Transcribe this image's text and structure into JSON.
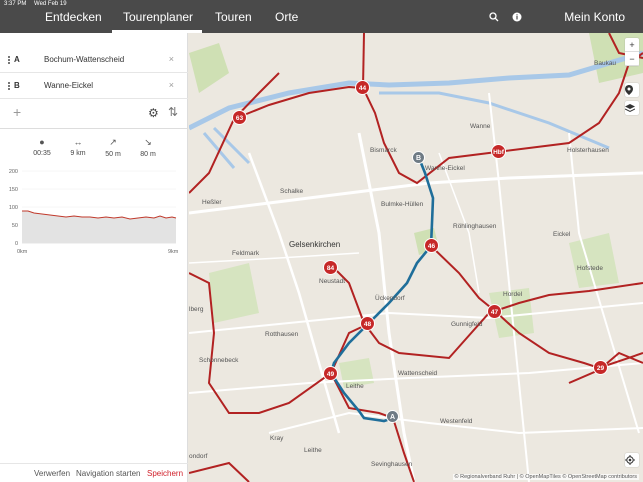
{
  "status": {
    "time": "3:37 PM",
    "date": "Wed Feb 19"
  },
  "nav": {
    "tabs": [
      "Entdecken",
      "Tourenplaner",
      "Touren",
      "Orte"
    ],
    "account": "Mein Konto"
  },
  "waypoints": [
    {
      "letter": "A",
      "name": "Bochum-Wattenscheid",
      "clear": "×"
    },
    {
      "letter": "B",
      "name": "Wanne-Eickel",
      "clear": "×"
    }
  ],
  "actions": {
    "add": "+",
    "settings": "⚙",
    "swap": "⇅"
  },
  "stats": [
    {
      "icon": "●",
      "value": "00:35"
    },
    {
      "icon": "↔",
      "value": "9 km"
    },
    {
      "icon": "↗",
      "value": "50 m"
    },
    {
      "icon": "↘",
      "value": "80 m"
    }
  ],
  "profile": {
    "y_ticks": [
      "200",
      "150",
      "100",
      "50",
      "0"
    ],
    "x_start": "0km",
    "x_end": "9km"
  },
  "footer": {
    "discard": "Verwerfen",
    "navigate": "Navigation starten",
    "save": "Speichern"
  },
  "map": {
    "labels": [
      "Baukau",
      "Wanne",
      "Bismarck",
      "Holsterhausen",
      "Schalke",
      "Heßler",
      "Bulmke-Hüllen",
      "Wanne-Eickel",
      "Röhlinghausen",
      "Eickel",
      "Gelsenkirchen",
      "Feldmark",
      "Hofstede",
      "Neustadt",
      "Ückendorf",
      "Hordel",
      "Gunnigfeld",
      "Rotthausen",
      "Schonnebeck",
      "Leithe",
      "Wattenscheid",
      "Westenfeld",
      "Kray",
      "Leithe",
      "Sevinghausen",
      "lberg",
      "ondorf"
    ],
    "badges": [
      "44",
      "63",
      "Hbf",
      "46",
      "84",
      "48",
      "47",
      "49",
      "29"
    ],
    "markers": [
      "B",
      "A"
    ],
    "zoom_in": "+",
    "zoom_out": "−",
    "attribution": "© Regionalverband Ruhr | © OpenMapTiles © OpenStreetMap contributors"
  }
}
